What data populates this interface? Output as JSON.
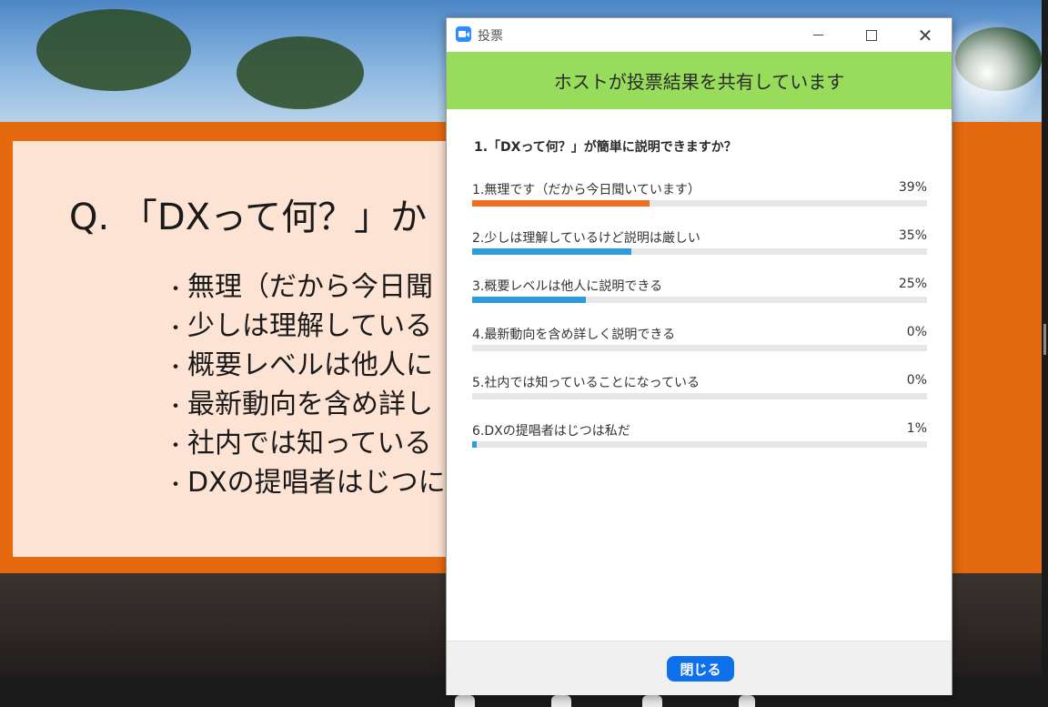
{
  "window": {
    "title": "投票"
  },
  "banner": {
    "text": "ホストが投票結果を共有しています"
  },
  "poll": {
    "question": "1.「DXって何？」が簡単に説明できますか？",
    "answers": [
      {
        "label": "1.無理です（だから今日聞いています）",
        "percent": "39%",
        "value": 0.39,
        "color": "#f26d21"
      },
      {
        "label": "2.少しは理解しているけど説明は厳しい",
        "percent": "35%",
        "value": 0.35,
        "color": "#2d9cdb"
      },
      {
        "label": "3.概要レベルは他人に説明できる",
        "percent": "25%",
        "value": 0.25,
        "color": "#2d9cdb"
      },
      {
        "label": "4.最新動向を含め詳しく説明できる",
        "percent": "0%",
        "value": 0.0,
        "color": "#2d9cdb"
      },
      {
        "label": "5.社内では知っていることになっている",
        "percent": "0%",
        "value": 0.0,
        "color": "#2d9cdb"
      },
      {
        "label": "6.DXの提唱者はじつは私だ",
        "percent": "1%",
        "value": 0.01,
        "color": "#2d9cdb"
      }
    ]
  },
  "footer": {
    "close_label": "閉じる"
  },
  "slide": {
    "question": "Q. 「DXって何？」か",
    "bullets": [
      "無理（だから今日聞",
      "少しは理解している",
      "概要レベルは他人に",
      "最新動向を含め詳し",
      "社内では知っている",
      "DXの提唱者はじつに"
    ]
  }
}
